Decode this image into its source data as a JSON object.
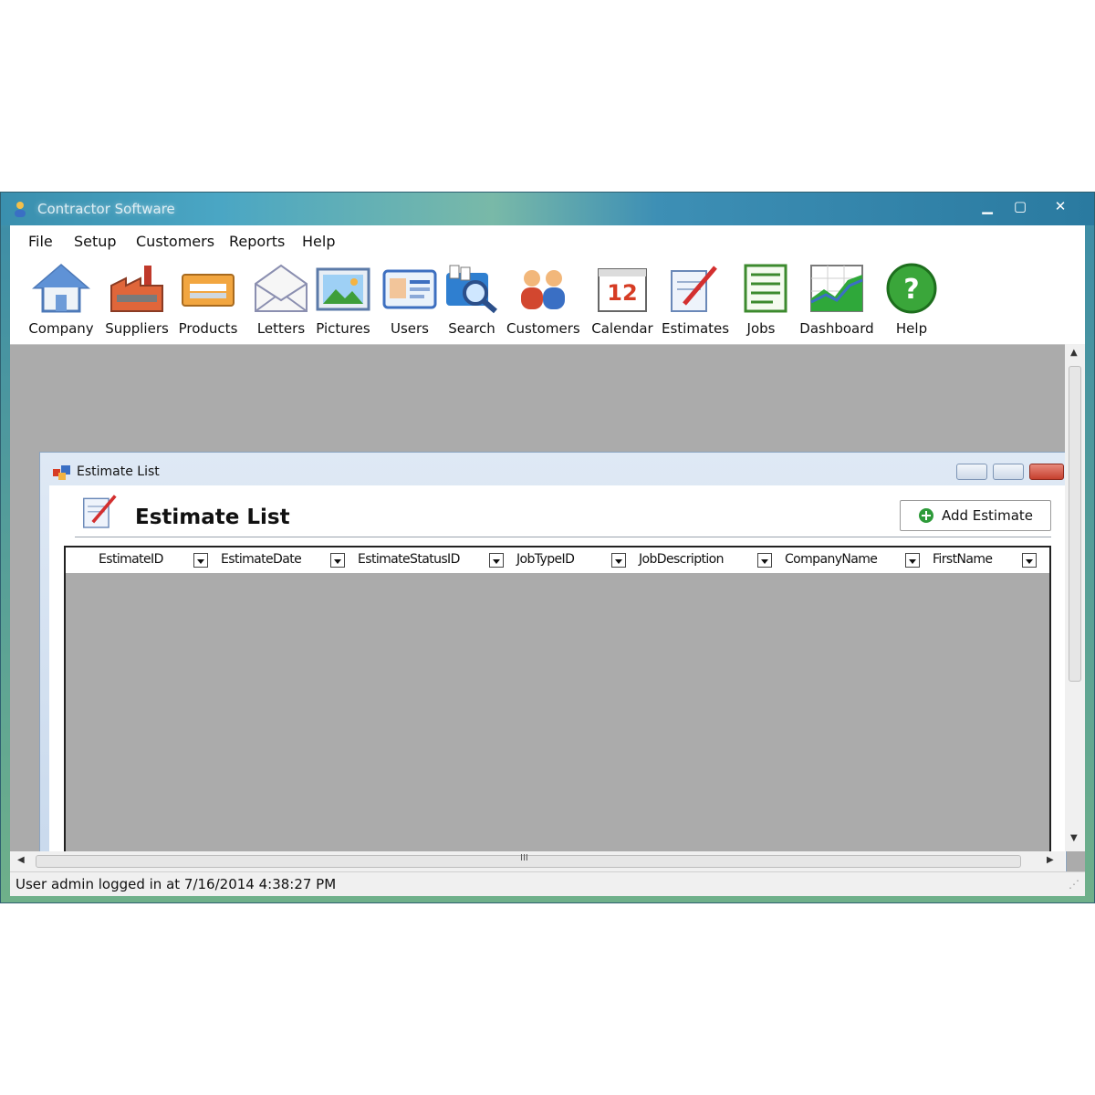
{
  "window": {
    "title": "Contractor Software"
  },
  "menu": [
    "File",
    "Setup",
    "Customers",
    "Reports",
    "Help"
  ],
  "toolbar": [
    {
      "label": "Company",
      "icon": "house-icon"
    },
    {
      "label": "Suppliers",
      "icon": "factory-icon"
    },
    {
      "label": "Products",
      "icon": "product-box-icon"
    },
    {
      "label": "Letters",
      "icon": "envelope-icon"
    },
    {
      "label": "Pictures",
      "icon": "picture-icon"
    },
    {
      "label": "Users",
      "icon": "id-card-icon"
    },
    {
      "label": "Search",
      "icon": "magnifier-icon"
    },
    {
      "label": "Customers",
      "icon": "people-icon"
    },
    {
      "label": "Calendar",
      "icon": "calendar-icon"
    },
    {
      "label": "Estimates",
      "icon": "estimate-pen-icon"
    },
    {
      "label": "Jobs",
      "icon": "clipboard-icon"
    },
    {
      "label": "Dashboard",
      "icon": "chart-icon"
    },
    {
      "label": "Help",
      "icon": "help-icon"
    }
  ],
  "calendar_day": "12",
  "child": {
    "title": "Estimate List",
    "header": "Estimate List",
    "add_button": "Add Estimate"
  },
  "grid": {
    "columns": [
      "EstimateID",
      "EstimateDate",
      "EstimateStatusID",
      "JobTypeID",
      "JobDescription",
      "CompanyName",
      "FirstName"
    ]
  },
  "hscroll_grip": "III",
  "status": "User admin logged in at 7/16/2014 4:38:27 PM"
}
